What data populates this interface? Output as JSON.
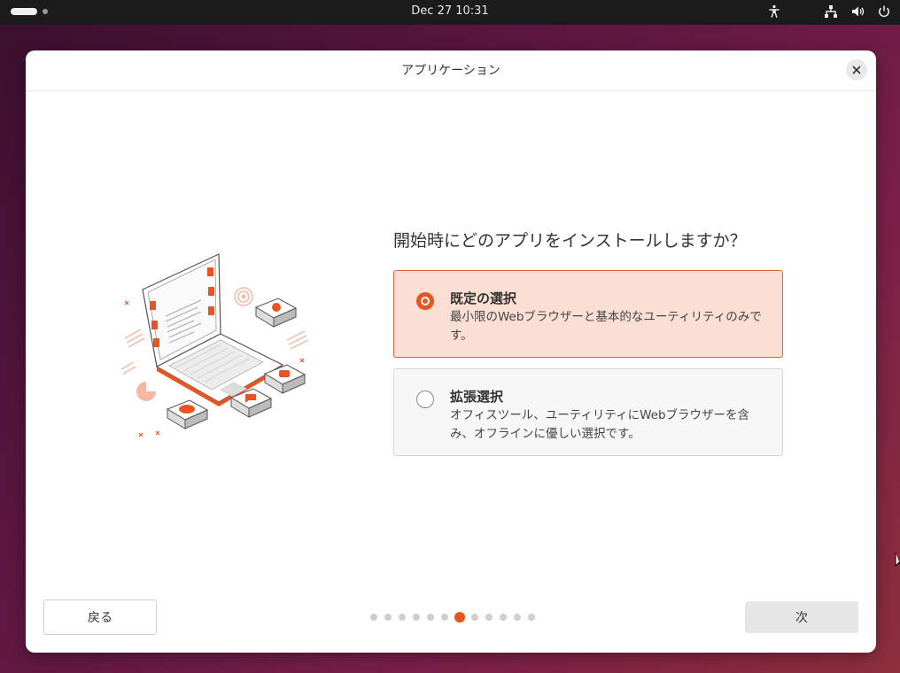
{
  "topbar": {
    "clock": "Dec 27  10:31",
    "icons": [
      "activities-indicator",
      "accessibility-icon",
      "network-icon",
      "volume-icon",
      "power-icon"
    ]
  },
  "dialog": {
    "title": "アプリケーション",
    "question": "開始時にどのアプリをインストールしますか？",
    "options": [
      {
        "title": "既定の選択",
        "description": "最小限のWebブラウザーと基本的なユーティリティのみです。",
        "selected": true
      },
      {
        "title": "拡張選択",
        "description": "オフィスツール、ユーティリティにWebブラウザーを含み、オフラインに優しい選択です。",
        "selected": false
      }
    ],
    "back_label": "戻る",
    "next_label": "次",
    "pagination": {
      "total": 12,
      "current": 7
    }
  },
  "colors": {
    "accent": "#e95420",
    "selected_bg": "#fbdfd4",
    "topbar_bg": "#1b1b1b"
  }
}
